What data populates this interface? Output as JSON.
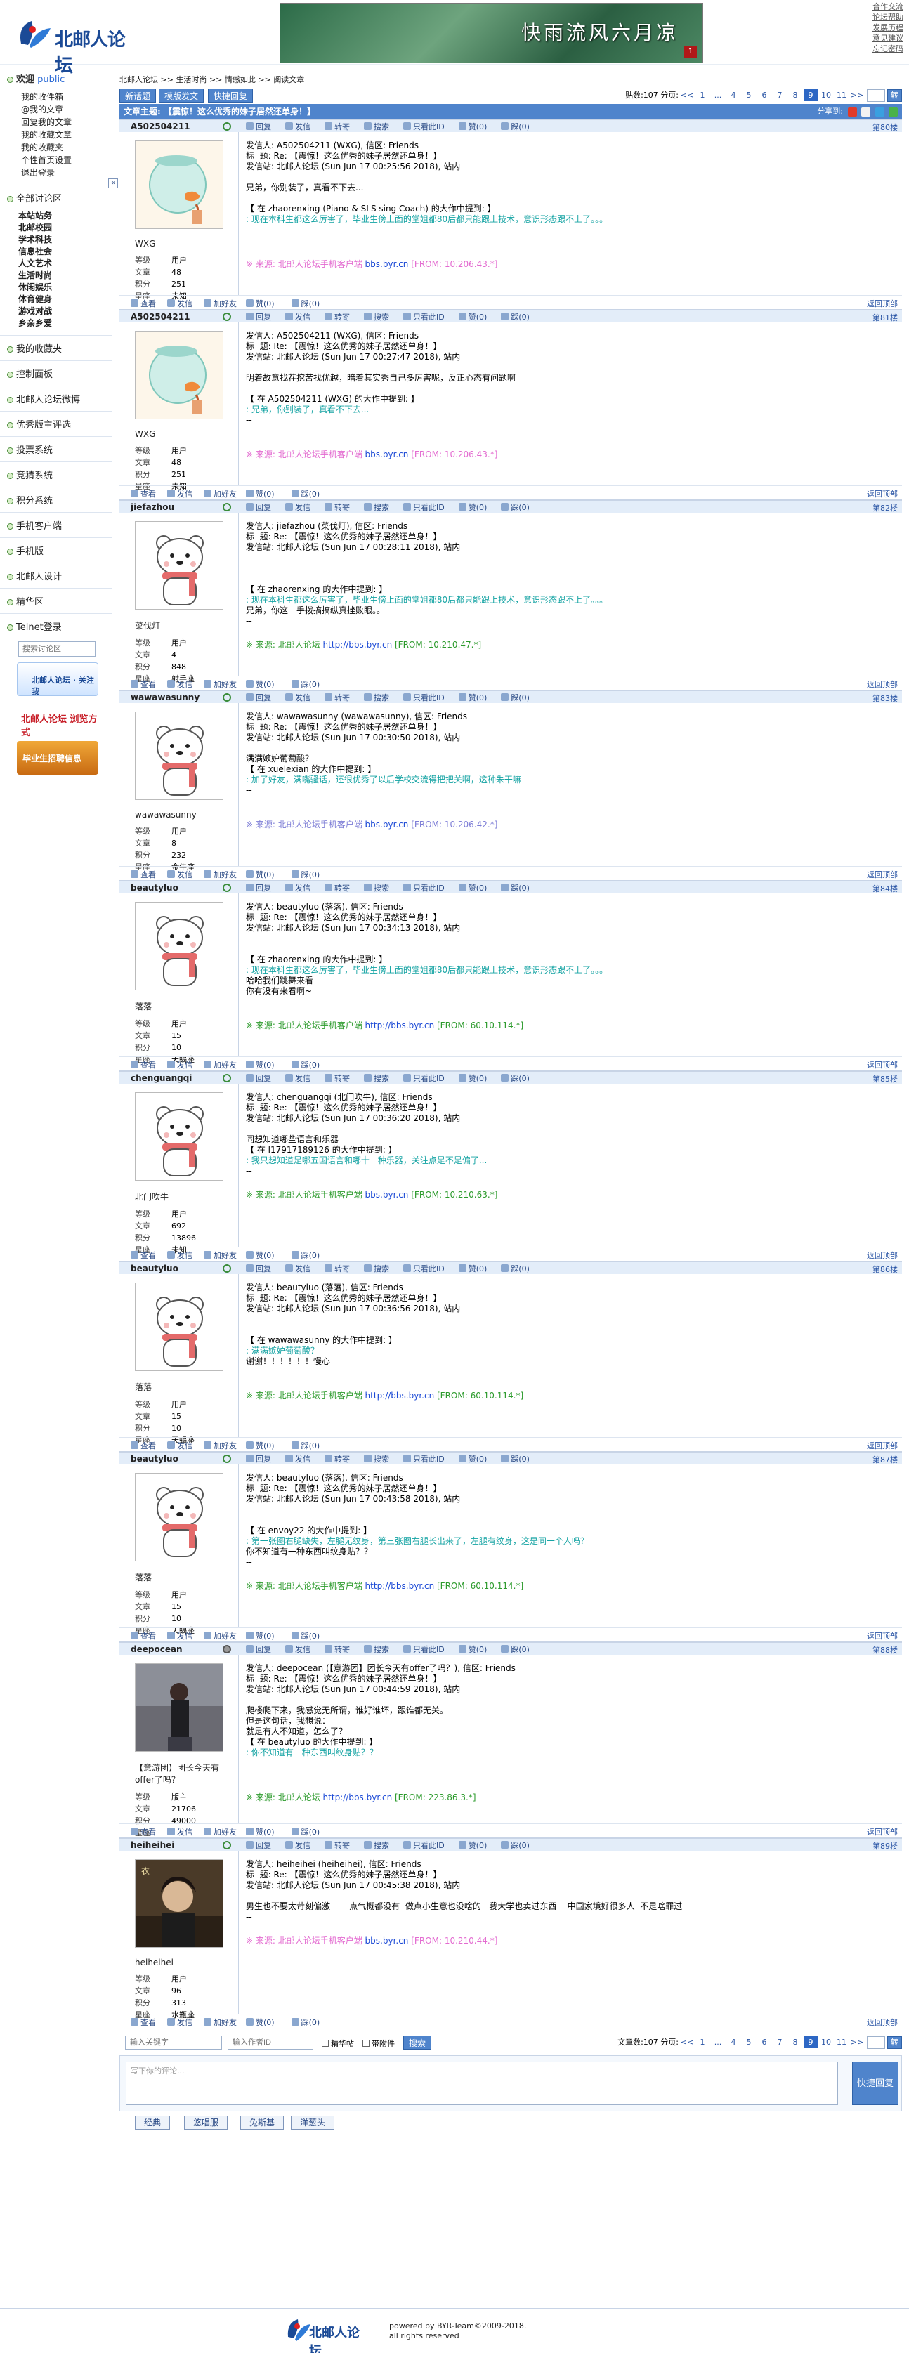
{
  "top_links": [
    "合作交流",
    "论坛帮助",
    "发展历程",
    "意见建议",
    "忘记密码"
  ],
  "site": {
    "logo_text": "北邮人论坛",
    "banner_text": "快雨流风六月凉",
    "banner_badge": "1"
  },
  "sidebar": {
    "welcome": "欢迎",
    "user": "public",
    "links": [
      "我的收件箱",
      "@我的文章",
      "回复我的文章",
      "我的收藏文章",
      "我的收藏夹",
      "个性首页设置",
      "退出登录"
    ],
    "sections_title": "全部讨论区",
    "sections": [
      "本站站务",
      "北邮校园",
      "学术科技",
      "信息社会",
      "人文艺术",
      "生活时尚",
      "休闲娱乐",
      "体育健身",
      "游戏对战",
      "乡亲乡爱"
    ],
    "items": [
      "我的收藏夹",
      "控制面板",
      "北邮人论坛微博",
      "优秀版主评选",
      "投票系统",
      "竞猜系统",
      "积分系统",
      "手机客户端",
      "手机版",
      "北邮人设计",
      "精华区",
      "Telnet登录"
    ],
    "search_placeholder": "搜索讨论区",
    "promo1": "北邮人论坛 · 关注我",
    "promo2": "北邮人论坛 浏览方式",
    "promo3": "毕业生招聘信息"
  },
  "breadcrumb": [
    "北邮人论坛",
    ">>",
    "生活时尚",
    ">>",
    "情感如此",
    ">>",
    "阅读文章"
  ],
  "toolbar": {
    "new_post": "新话题",
    "template_post": "模版发文",
    "quick_reply": "快捷回复"
  },
  "pager": {
    "count_label": "贴数:107",
    "pages_label": "分页:",
    "prev": "<<",
    "pages": [
      "1",
      "...",
      "4",
      "5",
      "6",
      "7",
      "8",
      "9",
      "10",
      "11"
    ],
    "current": "9",
    "next": ">>",
    "go": "转"
  },
  "title_bar": {
    "label": "文章主题: 【震惊！这么优秀的妹子居然还单身！】",
    "share": "分享到:"
  },
  "action_labels": {
    "reply": "回复",
    "mail": "发信",
    "forward": "转寄",
    "search": "搜索",
    "only_id": "只看此ID",
    "up": "赞",
    "down": "踩"
  },
  "foot_labels": {
    "view": "查看",
    "msg": "发信",
    "friend": "加好友",
    "up": "赞(0)",
    "down": "踩(0)",
    "top": "返回顶部"
  },
  "stat_labels": {
    "level": "等级",
    "posts": "文章",
    "score": "积分",
    "star": "星座"
  },
  "posts": [
    {
      "author": "A502504211",
      "gender": "m",
      "floor": "第80楼",
      "name": "WXG",
      "level": "用户",
      "posts": "48",
      "score": "251",
      "star": "未知",
      "avatar": "fish",
      "lines": [
        [
          "发信人: A502504211 (WXG), 信区: Friends",
          ""
        ],
        [
          "标  题: Re: 【震惊！这么优秀的妹子居然还单身！】",
          ""
        ],
        [
          "发信站: 北邮人论坛 (Sun Jun 17 00:25:56 2018), 站内",
          ""
        ],
        [
          "",
          ""
        ],
        [
          "兄弟，你别装了，真看不下去...",
          ""
        ],
        [
          "",
          ""
        ],
        [
          "【 在 zhaorenxing (Piano & SLS sing Coach) 的大作中提到: 】",
          ""
        ],
        [
          ": 现在本科生都这么厉害了，毕业生傍上面的堂姐都80后都只能跟上技术，意识形态跟不上了。。。",
          "q"
        ],
        [
          "--",
          ""
        ],
        [
          "",
          ""
        ],
        [
          "",
          ""
        ]
      ],
      "src": [
        "※ 来源: 北邮人论坛手机客户端 ",
        "bbs.byr.cn ",
        "[FROM: 10.206.43.*]"
      ],
      "src_color": "#e36ad0"
    },
    {
      "author": "A502504211",
      "gender": "m",
      "floor": "第81楼",
      "name": "WXG",
      "level": "用户",
      "posts": "48",
      "score": "251",
      "star": "未知",
      "avatar": "fish",
      "lines": [
        [
          "发信人: A502504211 (WXG), 信区: Friends",
          ""
        ],
        [
          "标  题: Re: 【震惊！这么优秀的妹子居然还单身！】",
          ""
        ],
        [
          "发信站: 北邮人论坛 (Sun Jun 17 00:27:47 2018), 站内",
          ""
        ],
        [
          "",
          ""
        ],
        [
          "明着故意找茬挖苦找优越，暗着其实秀自己多厉害呢，反正心态有问题啊",
          ""
        ],
        [
          "",
          ""
        ],
        [
          "【 在 A502504211 (WXG) 的大作中提到: 】",
          ""
        ],
        [
          ": 兄弟，你别装了，真看不下去...",
          "q"
        ],
        [
          "--",
          ""
        ],
        [
          "",
          ""
        ],
        [
          "",
          ""
        ]
      ],
      "src": [
        "※ 来源: 北邮人论坛手机客户端 ",
        "bbs.byr.cn ",
        "[FROM: 10.206.43.*]"
      ],
      "src_color": "#e36ad0"
    },
    {
      "author": "jiefazhou",
      "gender": "m",
      "floor": "第82楼",
      "name": "菜伐灯",
      "level": "用户",
      "posts": "4",
      "score": "848",
      "star": "射手座",
      "avatar": "bear",
      "lines": [
        [
          "发信人: jiefazhou (菜伐灯), 信区: Friends",
          ""
        ],
        [
          "标  题: Re: 【震惊！这么优秀的妹子居然还单身！】",
          ""
        ],
        [
          "发信站: 北邮人论坛 (Sun Jun 17 00:28:11 2018), 站内",
          ""
        ],
        [
          "",
          ""
        ],
        [
          "",
          ""
        ],
        [
          "",
          ""
        ],
        [
          "【 在 zhaorenxing 的大作中提到: 】",
          ""
        ],
        [
          ": 现在本科生都这么厉害了，毕业生傍上面的堂姐都80后都只能跟上技术，意识形态跟不上了。。。",
          "q"
        ],
        [
          "兄弟，你这一手拨搞搞纵真挫败眼。。",
          ""
        ],
        [
          "--",
          ""
        ],
        [
          "",
          ""
        ]
      ],
      "src": [
        "※ 来源: 北邮人论坛 ",
        "http://bbs.byr.cn ",
        "[FROM: 10.210.47.*]"
      ],
      "src_color": "#2b9a2b"
    },
    {
      "author": "wawawasunny",
      "gender": "m",
      "floor": "第83楼",
      "name": "wawawasunny",
      "level": "用户",
      "posts": "8",
      "score": "232",
      "star": "金牛座",
      "avatar": "bear",
      "lines": [
        [
          "发信人: wawawasunny (wawawasunny), 信区: Friends",
          ""
        ],
        [
          "标  题: Re: 【震惊！这么优秀的妹子居然还单身！】",
          ""
        ],
        [
          "发信站: 北邮人论坛 (Sun Jun 17 00:30:50 2018), 站内",
          ""
        ],
        [
          "",
          ""
        ],
        [
          "满满嫉妒葡萄酸？",
          ""
        ],
        [
          "【 在 xuelexian 的大作中提到: 】",
          ""
        ],
        [
          ": 加了好友，满嘴骚话，还很优秀了以后学校交流得把把关啊，这种朱干嘛",
          "q"
        ],
        [
          "--",
          ""
        ],
        [
          "",
          ""
        ],
        [
          "",
          ""
        ]
      ],
      "src": [
        "※ 来源: 北邮人论坛手机客户端 ",
        "bbs.byr.cn ",
        "[FROM: 10.206.42.*]"
      ],
      "src_color": "#7d7dd6"
    },
    {
      "author": "beautyluo",
      "gender": "m",
      "floor": "第84楼",
      "name": "落落",
      "level": "用户",
      "posts": "15",
      "score": "10",
      "star": "天蝎座",
      "avatar": "bear",
      "lines": [
        [
          "发信人: beautyluo (落落), 信区: Friends",
          ""
        ],
        [
          "标  题: Re: 【震惊！这么优秀的妹子居然还单身！】",
          ""
        ],
        [
          "发信站: 北邮人论坛 (Sun Jun 17 00:34:13 2018), 站内",
          ""
        ],
        [
          "",
          ""
        ],
        [
          "",
          ""
        ],
        [
          "【 在 zhaorenxing 的大作中提到: 】",
          ""
        ],
        [
          ": 现在本科生都这么厉害了，毕业生傍上面的堂姐都80后都只能跟上技术，意识形态跟不上了。。。",
          "q"
        ],
        [
          "哈哈我们跳舞来看",
          ""
        ],
        [
          "你有没有来看啊~",
          ""
        ],
        [
          "--",
          ""
        ],
        [
          "",
          ""
        ]
      ],
      "src": [
        "※ 来源: 北邮人论坛手机客户端 ",
        "http://bbs.byr.cn ",
        "[FROM: 60.10.114.*]"
      ],
      "src_color": "#2b9a2b"
    },
    {
      "author": "chenguangqi",
      "gender": "m",
      "floor": "第85楼",
      "name": "北门吹牛",
      "level": "用户",
      "posts": "692",
      "score": "13896",
      "star": "未知",
      "avatar": "bear",
      "lines": [
        [
          "发信人: chenguangqi (北门吹牛), 信区: Friends",
          ""
        ],
        [
          "标  题: Re: 【震惊！这么优秀的妹子居然还单身！】",
          ""
        ],
        [
          "发信站: 北邮人论坛 (Sun Jun 17 00:36:20 2018), 站内",
          ""
        ],
        [
          "",
          ""
        ],
        [
          "同想知道哪些语言和乐器",
          ""
        ],
        [
          "【 在 l17917189126 的大作中提到: 】",
          ""
        ],
        [
          ": 我只想知道是哪五国语言和哪十一种乐器，关注点是不是偏了...",
          "q"
        ],
        [
          "--",
          ""
        ],
        [
          "",
          ""
        ]
      ],
      "src": [
        "※ 来源: 北邮人论坛手机客户端 ",
        "bbs.byr.cn ",
        "[FROM: 10.210.63.*]"
      ],
      "src_color": "#2b9a2b"
    },
    {
      "author": "beautyluo",
      "gender": "m",
      "floor": "第86楼",
      "name": "落落",
      "level": "用户",
      "posts": "15",
      "score": "10",
      "star": "天蝎座",
      "avatar": "bear",
      "lines": [
        [
          "发信人: beautyluo (落落), 信区: Friends",
          ""
        ],
        [
          "标  题: Re: 【震惊！这么优秀的妹子居然还单身！】",
          ""
        ],
        [
          "发信站: 北邮人论坛 (Sun Jun 17 00:36:56 2018), 站内",
          ""
        ],
        [
          "",
          ""
        ],
        [
          "",
          ""
        ],
        [
          "【 在 wawawasunny 的大作中提到: 】",
          ""
        ],
        [
          ": 满满嫉妒葡萄酸？",
          "q"
        ],
        [
          "谢谢！！！！！！慢心",
          ""
        ],
        [
          "--",
          ""
        ],
        [
          "",
          ""
        ]
      ],
      "src": [
        "※ 来源: 北邮人论坛手机客户端 ",
        "http://bbs.byr.cn ",
        "[FROM: 60.10.114.*]"
      ],
      "src_color": "#2b9a2b"
    },
    {
      "author": "beautyluo",
      "gender": "m",
      "floor": "第87楼",
      "name": "落落",
      "level": "用户",
      "posts": "15",
      "score": "10",
      "star": "天蝎座",
      "avatar": "bear",
      "lines": [
        [
          "发信人: beautyluo (落落), 信区: Friends",
          ""
        ],
        [
          "标  题: Re: 【震惊！这么优秀的妹子居然还单身！】",
          ""
        ],
        [
          "发信站: 北邮人论坛 (Sun Jun 17 00:43:58 2018), 站内",
          ""
        ],
        [
          "",
          ""
        ],
        [
          "",
          ""
        ],
        [
          "【 在 envoy22 的大作中提到: 】",
          ""
        ],
        [
          ": 第一张图右腿缺失，左腿无纹身，第三张图右腿长出来了，左腿有纹身，这是同一个人吗？",
          "q"
        ],
        [
          "你不知道有一种东西叫纹身贴？？",
          ""
        ],
        [
          "--",
          ""
        ],
        [
          "",
          ""
        ]
      ],
      "src": [
        "※ 来源: 北邮人论坛手机客户端 ",
        "http://bbs.byr.cn ",
        "[FROM: 60.10.114.*]"
      ],
      "src_color": "#2b9a2b"
    },
    {
      "author": "deepocean",
      "gender": "f",
      "floor": "第88楼",
      "name": "【意游团】团长今天有offer了吗？",
      "level": "版主",
      "posts": "21706",
      "score": "49000",
      "star": "",
      "avatar": "photo",
      "lines": [
        [
          "发信人: deepocean (【意游团】团长今天有offer了吗？), 信区: Friends",
          ""
        ],
        [
          "标  题: Re: 【震惊！这么优秀的妹子居然还单身！】",
          ""
        ],
        [
          "发信站: 北邮人论坛 (Sun Jun 17 00:44:59 2018), 站内",
          ""
        ],
        [
          "",
          ""
        ],
        [
          "爬楼爬下来，我感觉无所谓，谁好谁坏，跟谁都无关。",
          ""
        ],
        [
          "但是这句话，我想说：",
          ""
        ],
        [
          "就是有人不知道，怎么了？",
          ""
        ],
        [
          "【 在 beautyluo 的大作中提到: 】",
          ""
        ],
        [
          ": 你不知道有一种东西叫纹身贴？？",
          "q"
        ],
        [
          "",
          ""
        ],
        [
          "--",
          ""
        ],
        [
          "",
          ""
        ]
      ],
      "src": [
        "※ 来源: 北邮人论坛 ",
        "http://bbs.byr.cn ",
        "[FROM: 223.86.3.*]"
      ],
      "src_color": "#2b9a2b"
    },
    {
      "author": "heiheihei",
      "gender": "m",
      "floor": "第89楼",
      "name": "heiheihei",
      "level": "用户",
      "posts": "96",
      "score": "313",
      "star": "水瓶座",
      "avatar": "photo2",
      "lines": [
        [
          "发信人: heiheihei (heiheihei), 信区: Friends",
          ""
        ],
        [
          "标  题: Re: 【震惊！这么优秀的妹子居然还单身！】",
          ""
        ],
        [
          "发信站: 北邮人论坛 (Sun Jun 17 00:45:38 2018), 站内",
          ""
        ],
        [
          "",
          ""
        ],
        [
          "男生也不要太苛刻偏激    一点气概都没有  做点小生意也没啥的   我大学也卖过东西    中国家境好很多人  不是啥罪过",
          ""
        ],
        [
          "--",
          ""
        ],
        [
          "",
          ""
        ]
      ],
      "src": [
        "※ 来源: 北邮人论坛手机客户端 ",
        "bbs.byr.cn ",
        "[FROM: 10.210.44.*]"
      ],
      "src_color": "#e36ad0"
    }
  ],
  "bottom": {
    "search_placeholder": "输入关键字",
    "author_placeholder": "输入作者ID",
    "elite": "精华帖",
    "attach": "带附件",
    "search_btn": "搜索",
    "count_label": "文章数:107",
    "pages_label": "分页:"
  },
  "reply": {
    "placeholder": "写下你的评论...",
    "button": "快捷回复"
  },
  "friend_links": [
    "经典",
    "悠唱服",
    "兔斯基",
    "洋葱头"
  ],
  "footer": {
    "logo": "北邮人论坛",
    "line1": "powered by BYR-Team©2009-2018.",
    "line2": "all rights reserved"
  }
}
